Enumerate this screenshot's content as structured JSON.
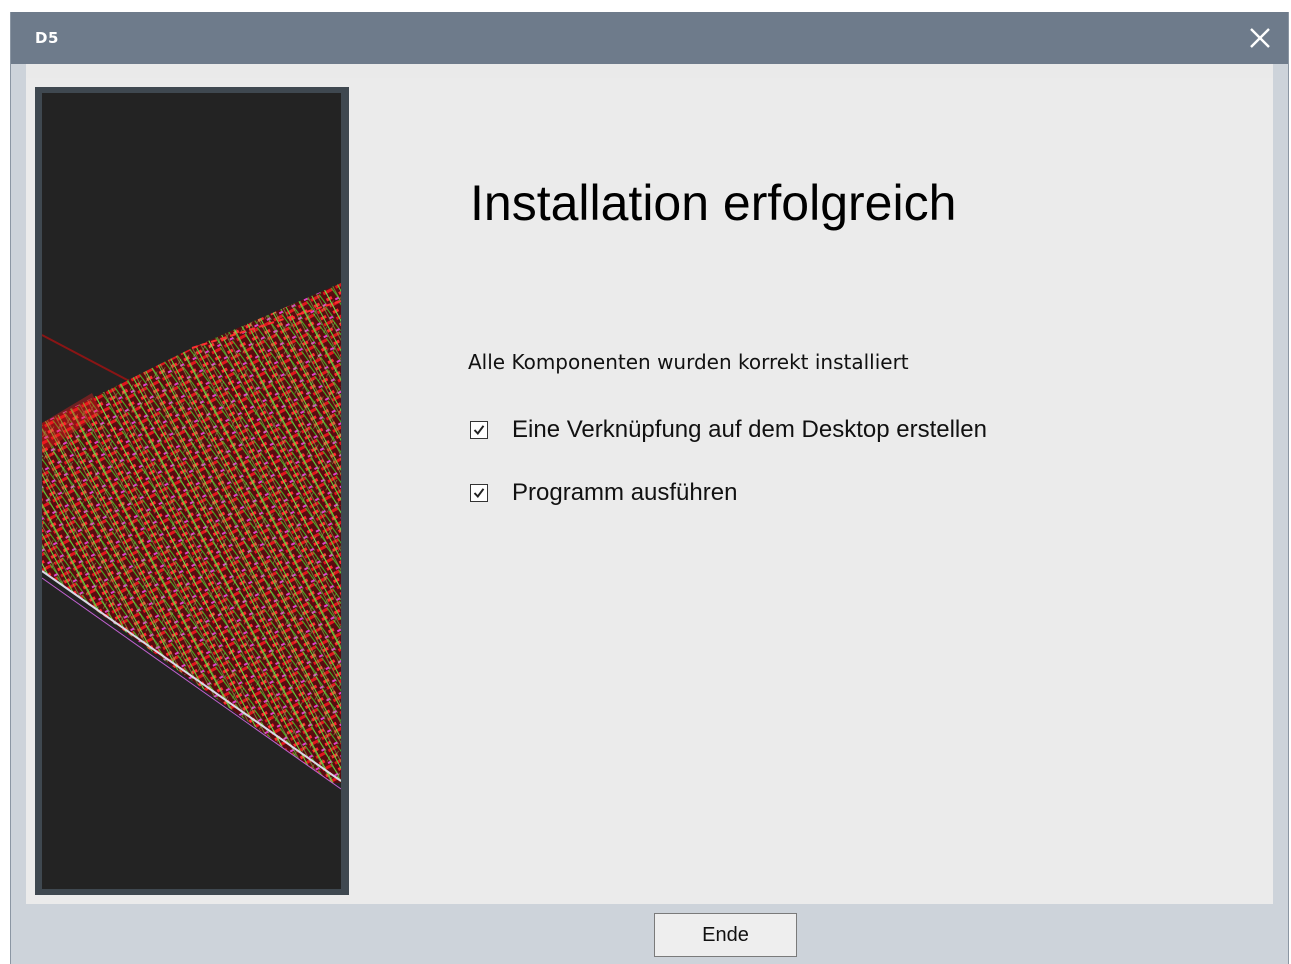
{
  "window": {
    "title": "D5",
    "close_icon": "close-icon"
  },
  "page": {
    "heading": "Installation erfolgreich",
    "message": "Alle Komponenten wurden korrekt installiert"
  },
  "options": [
    {
      "label": "Eine Verknüpfung auf dem Desktop erstellen",
      "checked": true
    },
    {
      "label": "Programm ausführen",
      "checked": true
    }
  ],
  "footer": {
    "end_label": "Ende"
  },
  "colors": {
    "titlebar": "#6e7b8b",
    "frame": "#cdd3da",
    "content_bg": "#ebebeb",
    "image_frame": "#3f4850",
    "image_bg": "#232323"
  }
}
